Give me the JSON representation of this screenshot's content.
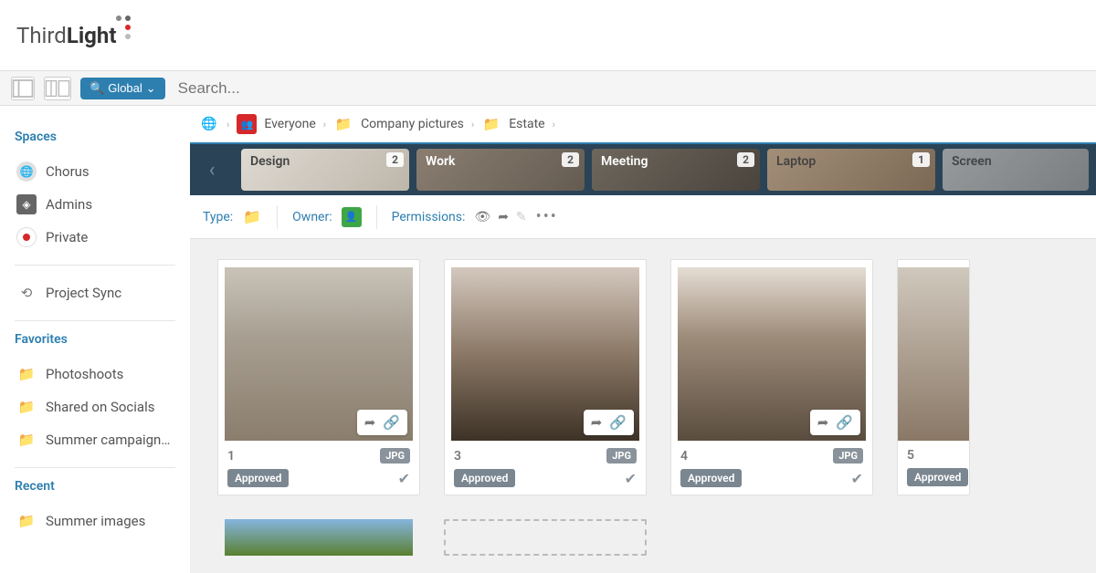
{
  "brand": {
    "part1": "Third",
    "part2": "Light"
  },
  "toolbar": {
    "global_label": "Global",
    "search_placeholder": "Search..."
  },
  "sidebar": {
    "spaces_title": "Spaces",
    "spaces": [
      {
        "label": "Chorus"
      },
      {
        "label": "Admins"
      },
      {
        "label": "Private"
      }
    ],
    "sync_label": "Project Sync",
    "favorites_title": "Favorites",
    "favorites": [
      {
        "label": "Photoshoots"
      },
      {
        "label": "Shared on Socials"
      },
      {
        "label": "Summer campaign…"
      }
    ],
    "recent_title": "Recent",
    "recent": [
      {
        "label": "Summer images"
      }
    ]
  },
  "breadcrumb": {
    "items": [
      "Everyone",
      "Company pictures",
      "Estate"
    ]
  },
  "tabs": [
    {
      "label": "Design",
      "count": "2"
    },
    {
      "label": "Work",
      "count": "2"
    },
    {
      "label": "Meeting",
      "count": "2"
    },
    {
      "label": "Laptop",
      "count": "1"
    },
    {
      "label": "Screen",
      "count": ""
    }
  ],
  "meta": {
    "type_label": "Type:",
    "owner_label": "Owner:",
    "permissions_label": "Permissions:"
  },
  "assets": [
    {
      "num": "1",
      "fmt": "JPG",
      "status": "Approved"
    },
    {
      "num": "3",
      "fmt": "JPG",
      "status": "Approved"
    },
    {
      "num": "4",
      "fmt": "JPG",
      "status": "Approved"
    },
    {
      "num": "5",
      "fmt": "",
      "status": "Approved"
    }
  ]
}
